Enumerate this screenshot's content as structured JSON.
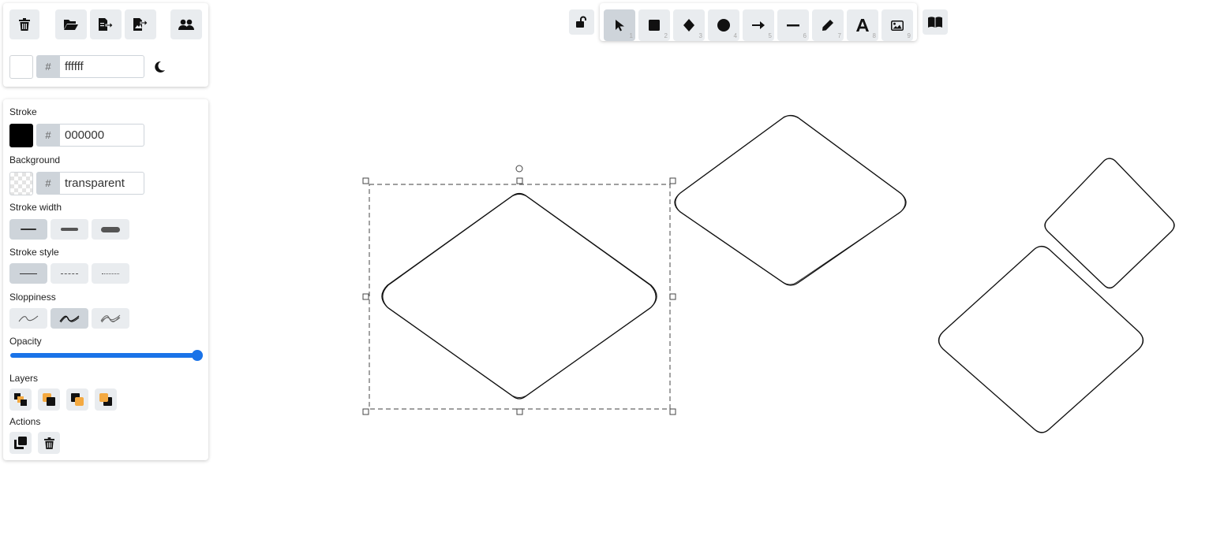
{
  "canvas_background": {
    "swatch_color": "#ffffff",
    "hash": "#",
    "value": "ffffff"
  },
  "top_panel_icons": [
    "trash-icon",
    "folder-open-icon",
    "export-file-icon",
    "export-image-icon",
    "collaborators-icon",
    "moon-icon"
  ],
  "properties": {
    "stroke": {
      "label": "Stroke",
      "swatch_color": "#000000",
      "hash": "#",
      "value": "000000"
    },
    "background": {
      "label": "Background",
      "swatch_color": "transparent",
      "hash": "#",
      "value": "transparent"
    },
    "stroke_width": {
      "label": "Stroke width",
      "options": [
        "thin",
        "bold",
        "extra-bold"
      ],
      "selected": "thin"
    },
    "stroke_style": {
      "label": "Stroke style",
      "options": [
        "solid",
        "dashed",
        "dotted"
      ],
      "selected": "solid"
    },
    "sloppiness": {
      "label": "Sloppiness",
      "options": [
        "architect",
        "artist",
        "cartoonist"
      ],
      "selected": "artist"
    },
    "opacity": {
      "label": "Opacity",
      "value": 100
    },
    "layers": {
      "label": "Layers",
      "buttons": [
        "send-to-back",
        "send-backward",
        "bring-forward",
        "bring-to-front"
      ]
    },
    "actions": {
      "label": "Actions",
      "buttons": [
        "duplicate",
        "delete"
      ]
    }
  },
  "toolbar": {
    "lock_icon": "unlock-icon",
    "tools": [
      {
        "name": "selection",
        "number": "1",
        "selected": true
      },
      {
        "name": "rectangle",
        "number": "2",
        "selected": false
      },
      {
        "name": "diamond",
        "number": "3",
        "selected": false
      },
      {
        "name": "ellipse",
        "number": "4",
        "selected": false
      },
      {
        "name": "arrow",
        "number": "5",
        "selected": false
      },
      {
        "name": "line",
        "number": "6",
        "selected": false
      },
      {
        "name": "draw",
        "number": "7",
        "selected": false
      },
      {
        "name": "text",
        "number": "8",
        "selected": false
      },
      {
        "name": "image",
        "number": "9",
        "selected": false
      }
    ],
    "library_icon": "library-book-icon"
  },
  "colors": {
    "accent": "#1a73e8",
    "button_bg": "#e9ecef",
    "button_selected": "#ced4da",
    "layer_orange": "#f4a940"
  }
}
